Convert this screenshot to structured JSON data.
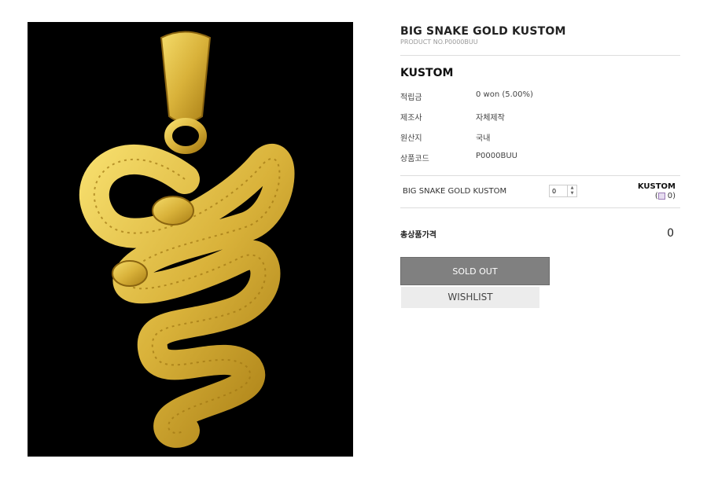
{
  "product": {
    "title": "BIG SNAKE GOLD KUSTOM",
    "product_no": "PRODUCT NO.P0000BUU",
    "price_label": "KUSTOM",
    "image_alt": "gold snake pendant"
  },
  "specs": [
    {
      "key": "적립금",
      "value": "0 won (5.00%)"
    },
    {
      "key": "제조사",
      "value": "자체제작"
    },
    {
      "key": "원산지",
      "value": "국내"
    },
    {
      "key": "상품코드",
      "value": "P0000BUU"
    }
  ],
  "option": {
    "name": "BIG SNAKE GOLD KUSTOM",
    "quantity": "0",
    "price": "KUSTOM",
    "mileage_prefix": "(",
    "mileage_value": "0)"
  },
  "total": {
    "label": "총상품가격",
    "value": "0"
  },
  "buttons": {
    "sold_out": "SOLD OUT",
    "wishlist": "WISHLIST"
  },
  "colors": {
    "gold": "#d9b23a",
    "sold_out_bg": "#808080"
  }
}
